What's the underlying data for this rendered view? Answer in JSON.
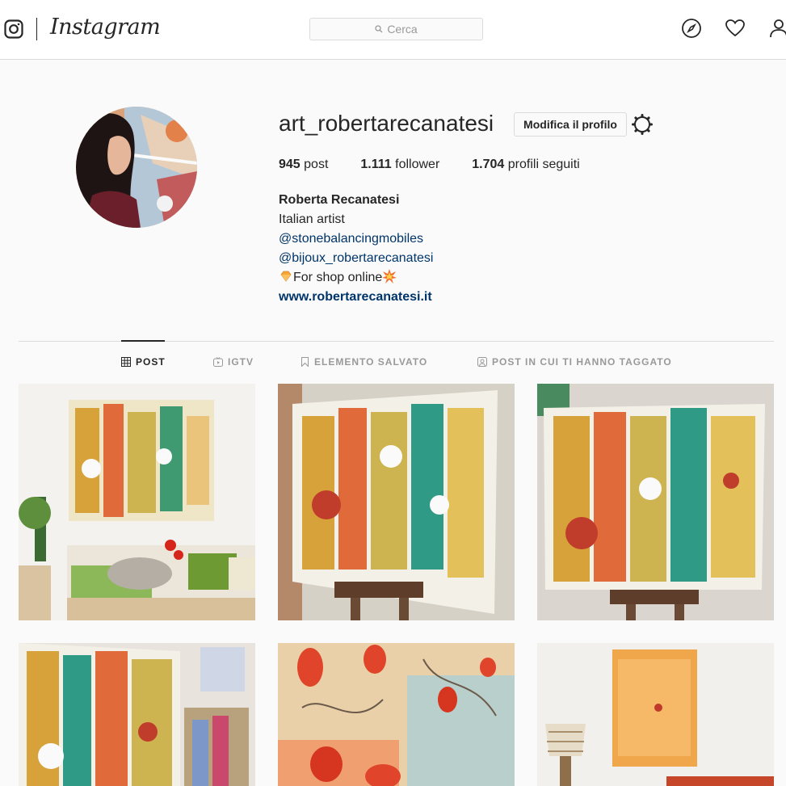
{
  "nav": {
    "wordmark": "Instagram",
    "search_placeholder": "Cerca",
    "icons": [
      "instagram-glyph-icon",
      "explore-compass-icon",
      "activity-heart-icon",
      "profile-user-icon"
    ]
  },
  "profile": {
    "username": "art_robertarecanatesi",
    "edit_button": "Modifica il profilo",
    "stats": {
      "posts_count": "945",
      "posts_label": "post",
      "followers_count": "1.111",
      "followers_label": "follower",
      "following_count": "1.704",
      "following_label": "profili seguiti"
    },
    "bio": {
      "name": "Roberta Recanatesi",
      "line1": "Italian artist",
      "mention1": "@stonebalancingmobiles",
      "mention2": "@bijoux_robertarecanatesi",
      "shop_line": "For shop online",
      "website": "www.robertarecanatesi.it"
    }
  },
  "tabs": [
    {
      "label": "POST",
      "active": true
    },
    {
      "label": "IGTV",
      "active": false
    },
    {
      "label": "ELEMENTO SALVATO",
      "active": false
    },
    {
      "label": "POST IN CUI TI HANNO TAGGATO",
      "active": false
    }
  ],
  "colors": {
    "link": "#003569",
    "border": "#dbdbdb",
    "text": "#262626",
    "muted": "#999999"
  }
}
